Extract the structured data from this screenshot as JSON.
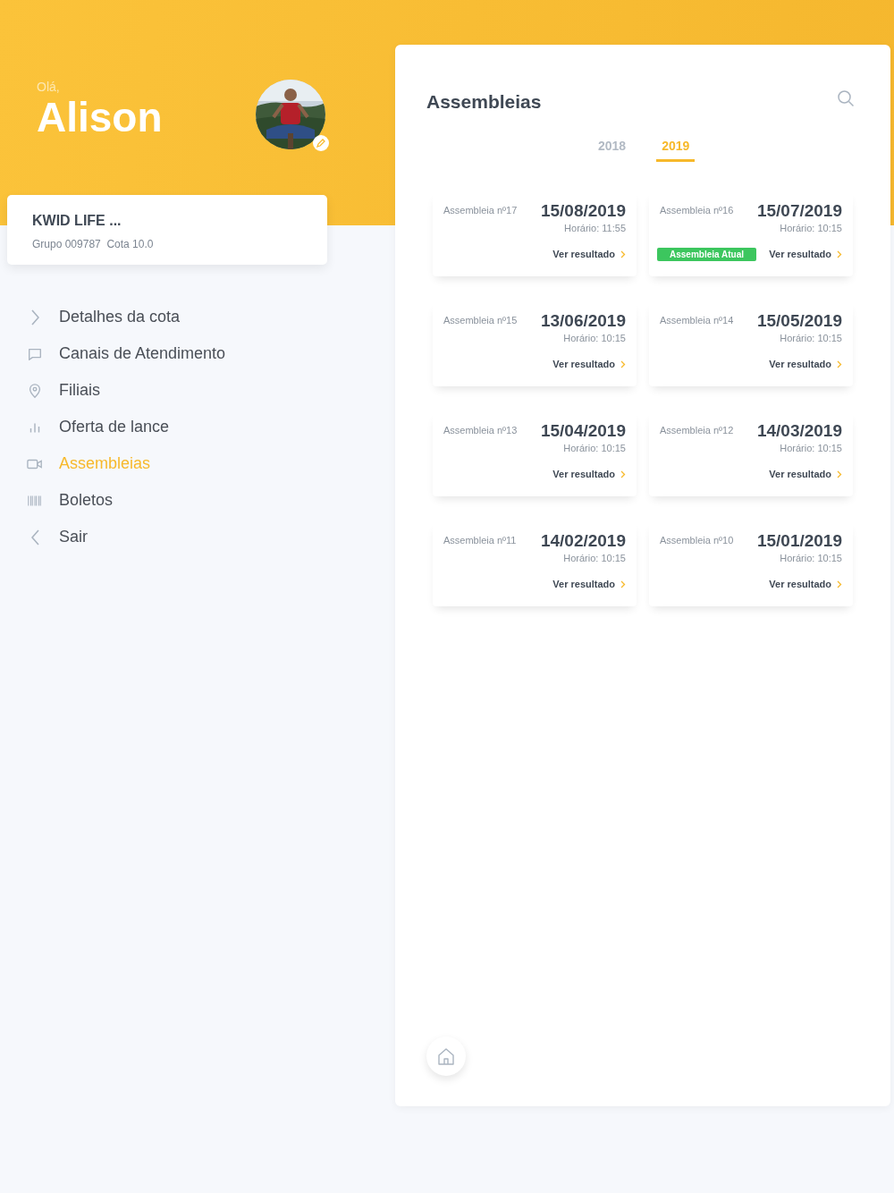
{
  "greeting": {
    "salutation": "Olá,",
    "name": "Alison"
  },
  "quota_card": {
    "title": "KWID LIFE ...",
    "subtitle": "Grupo 009787  Cota 10.0"
  },
  "menu": [
    {
      "kind": "chevron",
      "label": "Detalhes da cota",
      "selected": false
    },
    {
      "kind": "chat",
      "label": "Canais de Atendimento",
      "selected": false
    },
    {
      "kind": "pin",
      "label": "Filiais",
      "selected": false
    },
    {
      "kind": "chart",
      "label": "Oferta de lance",
      "selected": false
    },
    {
      "kind": "video",
      "label": "Assembleias",
      "selected": true
    },
    {
      "kind": "barcode",
      "label": "Boletos",
      "selected": false
    },
    {
      "kind": "back",
      "label": "Sair",
      "selected": false
    }
  ],
  "panel": {
    "title": "Assembleias",
    "tabs": [
      {
        "label": "2018",
        "selected": false
      },
      {
        "label": "2019",
        "selected": true
      }
    ],
    "assemblies": [
      {
        "number": "Assembleia nº17",
        "date": "15/08/2019",
        "time": "Horário: 11:55",
        "link": "Ver resultado"
      },
      {
        "number": "Assembleia nº16",
        "date": "15/07/2019",
        "time": "Horário: 10:15",
        "badge": "Assembleia Atual",
        "link": "Ver resultado"
      },
      {
        "number": "Assembleia nº15",
        "date": "13/06/2019",
        "time": "Horário: 10:15",
        "link": "Ver resultado"
      },
      {
        "number": "Assembleia nº14",
        "date": "15/05/2019",
        "time": "Horário: 10:15",
        "link": "Ver resultado"
      },
      {
        "number": "Assembleia nº13",
        "date": "15/04/2019",
        "time": "Horário: 10:15",
        "link": "Ver resultado"
      },
      {
        "number": "Assembleia nº12",
        "date": "14/03/2019",
        "time": "Horário: 10:15",
        "link": "Ver resultado"
      },
      {
        "number": "Assembleia nº11",
        "date": "14/02/2019",
        "time": "Horário: 10:15",
        "link": "Ver resultado"
      },
      {
        "number": "Assembleia nº10",
        "date": "15/01/2019",
        "time": "Horário: 10:15",
        "link": "Ver resultado"
      }
    ]
  }
}
